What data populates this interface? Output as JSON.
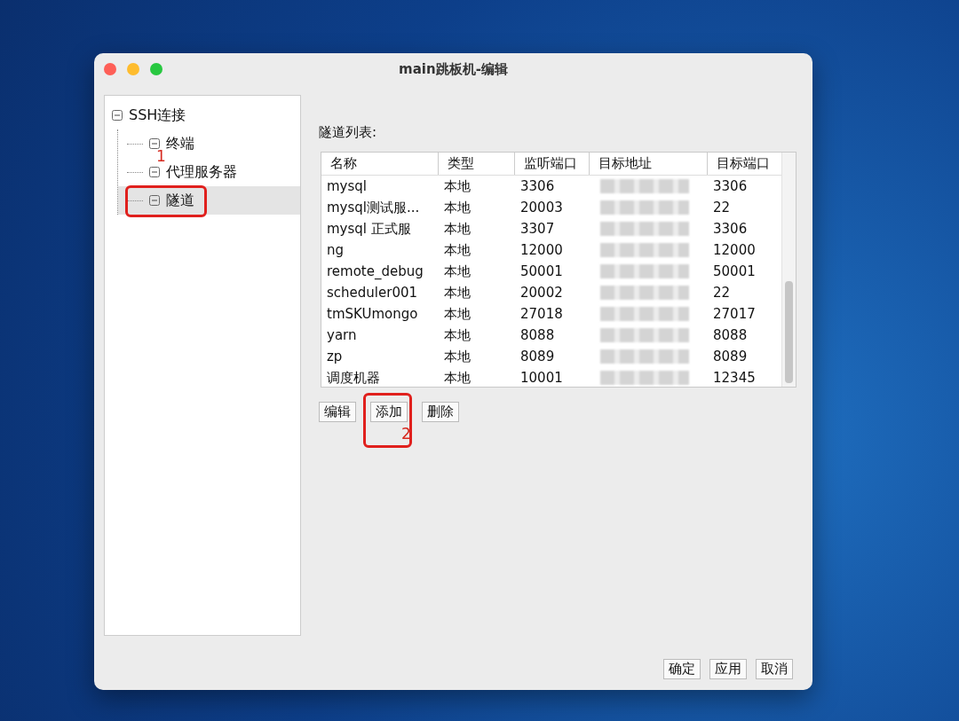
{
  "window": {
    "title": "main跳板机-编辑"
  },
  "tree": [
    {
      "label": "SSH连接",
      "expanded": true,
      "selected": false,
      "children": [
        {
          "label": "终端",
          "expanded": true,
          "selected": false
        },
        {
          "label": "代理服务器",
          "expanded": true,
          "selected": false
        },
        {
          "label": "隧道",
          "expanded": true,
          "selected": true
        }
      ]
    }
  ],
  "tunnel_list": {
    "label": "隧道列表:",
    "columns": [
      "名称",
      "类型",
      "监听端口",
      "目标地址",
      "目标端口"
    ],
    "rows": [
      {
        "name": "mysql",
        "type": "本地",
        "listen_port": "3306",
        "target_port": "3306"
      },
      {
        "name": "mysql测试服...",
        "type": "本地",
        "listen_port": "20003",
        "target_port": "22"
      },
      {
        "name": "mysql 正式服",
        "type": "本地",
        "listen_port": "3307",
        "target_port": "3306"
      },
      {
        "name": "ng",
        "type": "本地",
        "listen_port": "12000",
        "target_port": "12000"
      },
      {
        "name": "remote_debug",
        "type": "本地",
        "listen_port": "50001",
        "target_port": "50001"
      },
      {
        "name": "scheduler001",
        "type": "本地",
        "listen_port": "20002",
        "target_port": "22"
      },
      {
        "name": "tmSKUmongo",
        "type": "本地",
        "listen_port": "27018",
        "target_port": "27017"
      },
      {
        "name": "yarn",
        "type": "本地",
        "listen_port": "8088",
        "target_port": "8088"
      },
      {
        "name": "zp",
        "type": "本地",
        "listen_port": "8089",
        "target_port": "8089"
      },
      {
        "name": "调度机器",
        "type": "本地",
        "listen_port": "10001",
        "target_port": "12345"
      }
    ],
    "buttons": [
      "编辑",
      "添加",
      "删除"
    ]
  },
  "annotations": [
    "1",
    "2"
  ],
  "footer_buttons": [
    "确定",
    "应用",
    "取消"
  ]
}
